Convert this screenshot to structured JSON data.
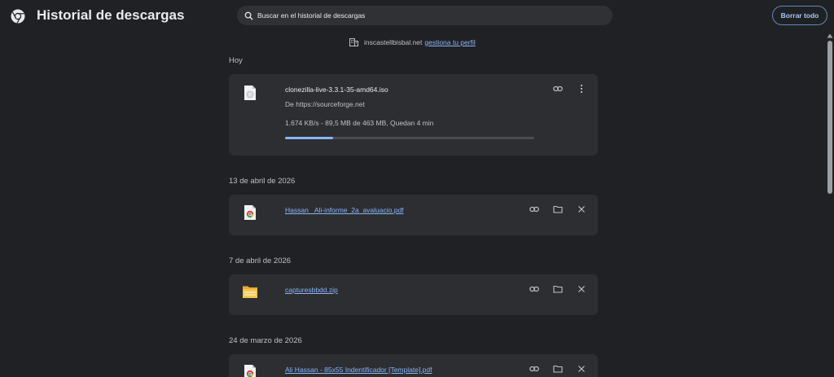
{
  "header": {
    "title": "Historial de descargas",
    "search_placeholder": "Buscar en el historial de descargas",
    "clear_all": "Borrar todo"
  },
  "managed": {
    "domain": "inscastellbisbal.net",
    "link": "gestiona tu perfil"
  },
  "groups": [
    {
      "date": "Hoy",
      "items": [
        {
          "name": "clonezilla-live-3.3.1-35-amd64.iso",
          "source": "De https://sourceforge.net",
          "status": "1.674 KB/s - 89,5 MB de 463 MB, Quedan 4 min",
          "progress_percent": 19.3,
          "icon": "disc-file-icon"
        }
      ]
    },
    {
      "date": "13 de abril de 2026",
      "items": [
        {
          "name": "Hassan _Ali-informe_2a_avaluacio.pdf",
          "icon": "chrome-pdf-icon"
        }
      ]
    },
    {
      "date": "7 de abril de 2026",
      "items": [
        {
          "name": "capturesbbdd.zip",
          "icon": "zip-folder-icon"
        }
      ]
    },
    {
      "date": "24 de marzo de 2026",
      "items": [
        {
          "name": "Ali Hassan - 85x55 Indentificador [Template].pdf",
          "icon": "chrome-pdf-icon"
        }
      ]
    }
  ],
  "colors": {
    "background": "#202124",
    "card": "#2d2e31",
    "accent": "#8ab4f8",
    "text": "#e8eaed"
  }
}
